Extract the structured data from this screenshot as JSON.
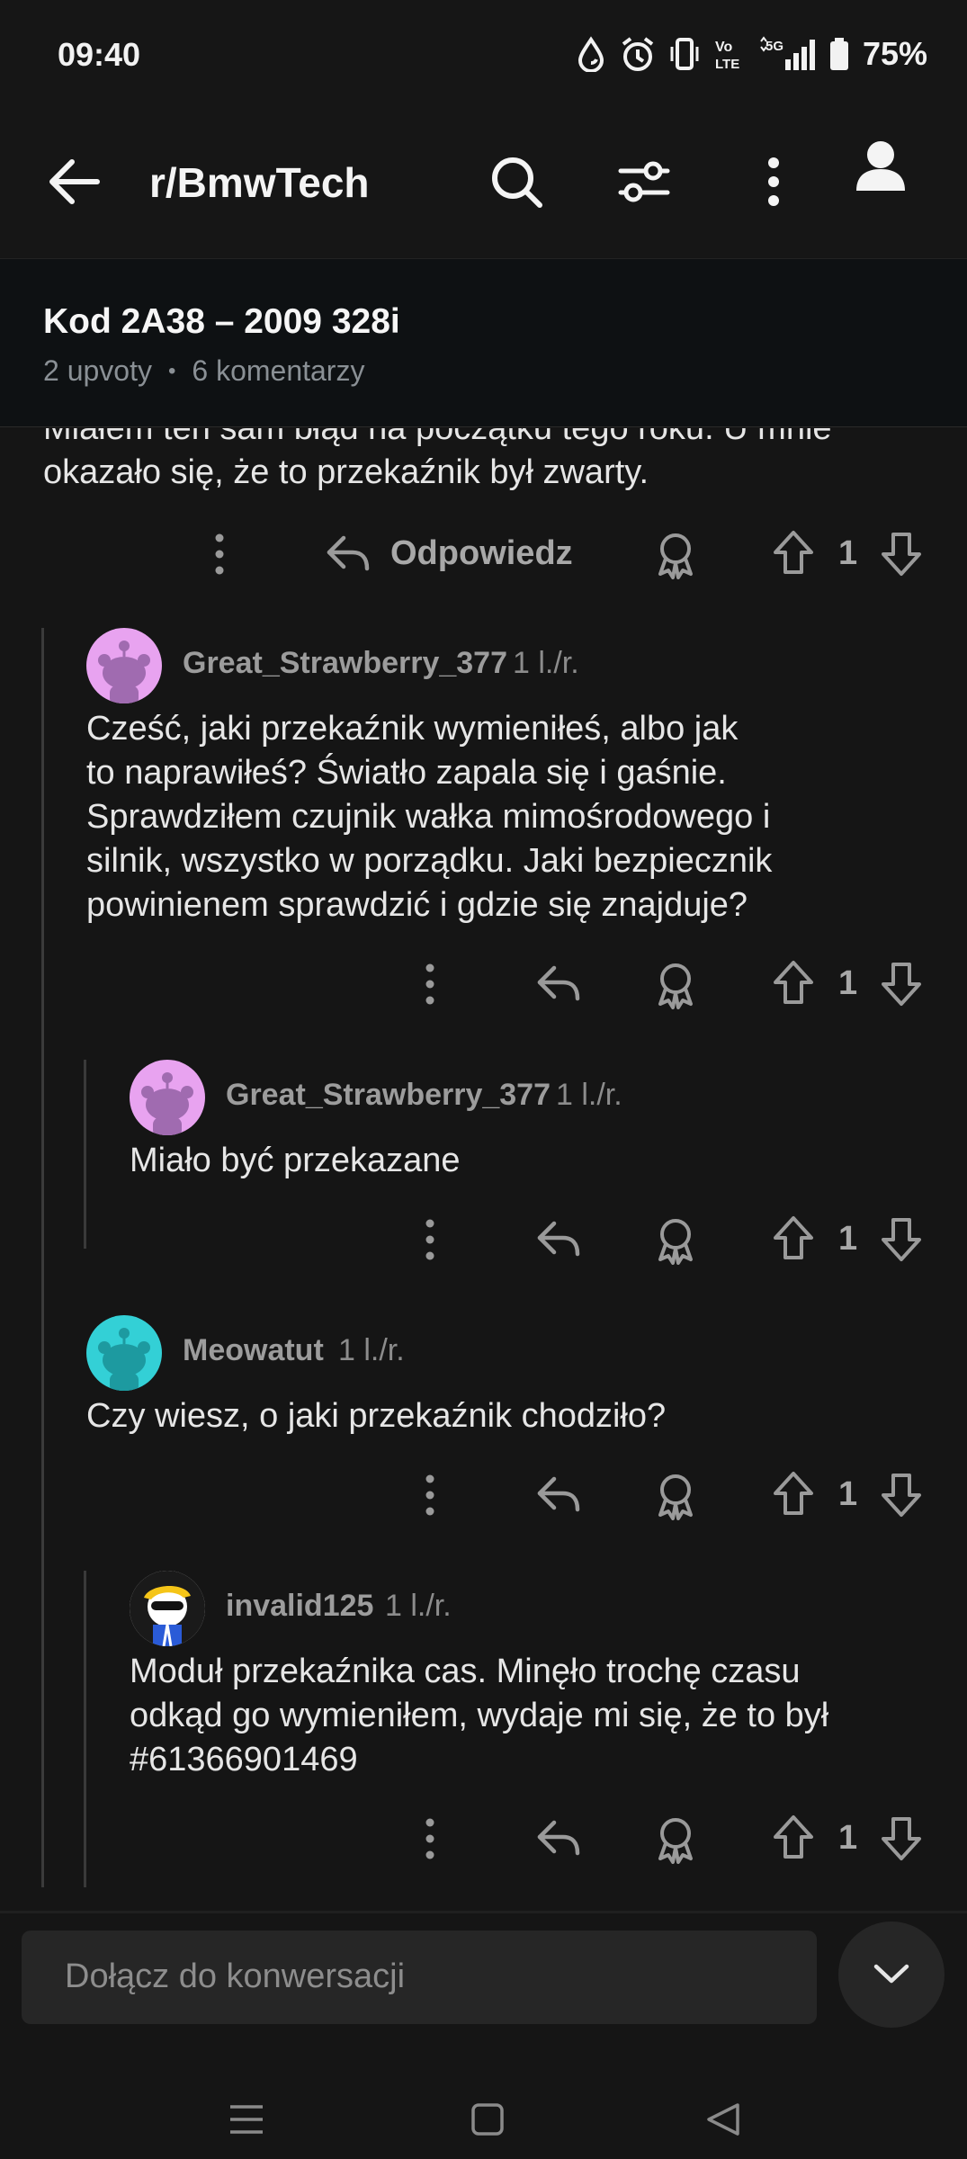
{
  "status_bar": {
    "time": "09:40",
    "battery": "75%"
  },
  "app_bar": {
    "subreddit": "r/BmwTech"
  },
  "post": {
    "title": "Kod 2A38 – 2009 328i",
    "upvotes": "2 upvoty",
    "separator": "•",
    "comments": "6 komentarzy"
  },
  "comments": [
    {
      "lines": [
        "Miałem ten sam błąd na początku tego roku. U mnie",
        "okazało się, że to przekaźnik był zwarty."
      ],
      "reply_label": "Odpowiedz",
      "votes": "1"
    },
    {
      "user": "Great_Strawberry_377",
      "age": "1 l./r.",
      "avatar_color": "#e8a3f0",
      "lines": [
        "Cześć, jaki przekaźnik wymieniłeś, albo jak",
        "to naprawiłeś? Światło zapala się i gaśnie.",
        "Sprawdziłem czujnik wałka mimośrodowego i",
        "silnik, wszystko w porządku. Jaki bezpiecznik",
        "powinienem sprawdzić i gdzie się znajduje?"
      ],
      "votes": "1"
    },
    {
      "user": "Great_Strawberry_377",
      "age": "1 l./r.",
      "avatar_color": "#e8a3f0",
      "lines": [
        "Miało być przekazane"
      ],
      "votes": "1"
    },
    {
      "user": "Meowatut",
      "age": "1 l./r.",
      "avatar_color": "#33d0d6",
      "lines": [
        "Czy wiesz, o jaki przekaźnik chodziło?"
      ],
      "votes": "1"
    },
    {
      "user": "invalid125",
      "age": "1 l./r.",
      "avatar_color": "#ffffff",
      "lines": [
        "Moduł przekaźnika cas. Minęło trochę czasu",
        "odkąd go wymieniłem, wydaje mi się, że to był",
        "#61366901469"
      ],
      "votes": "1"
    }
  ],
  "compose": {
    "placeholder": "Dołącz do konwersacji"
  },
  "colors": {
    "background": "#151515",
    "header": "#0e1113",
    "text": "#e6e6e6",
    "muted": "#8c8c8c"
  }
}
